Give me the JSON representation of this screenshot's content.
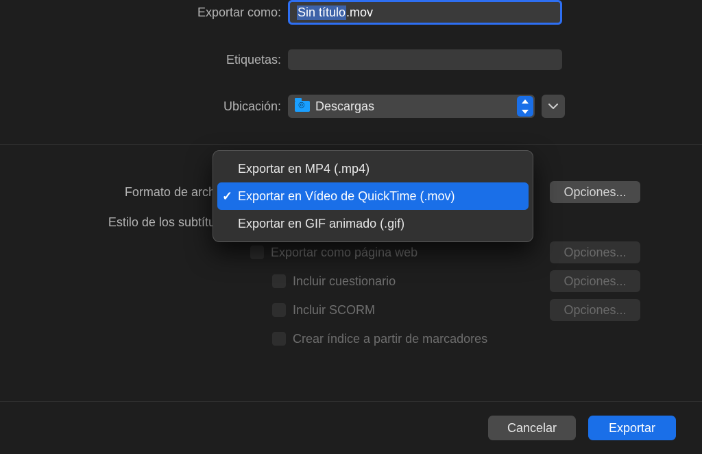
{
  "labels": {
    "export_as": "Exportar como:",
    "tags": "Etiquetas:",
    "location": "Ubicación:",
    "file_format": "Formato de archivo:",
    "subtitle_style": "Estilo de los subtítulos:"
  },
  "filename": {
    "selected_part": "Sin título",
    "rest_part": ".mov"
  },
  "location": {
    "name": "Descargas"
  },
  "format_menu": {
    "items": [
      "Exportar en MP4 (.mp4)",
      "Exportar en Vídeo de QuickTime (.mov)",
      "Exportar en GIF animado (.gif)"
    ],
    "selected_index": 1
  },
  "checkboxes": {
    "export_web": "Exportar como página web",
    "include_quiz": "Incluir cuestionario",
    "include_scorm": "Incluir SCORM",
    "create_index": "Crear índice a partir de marcadores"
  },
  "buttons": {
    "options": "Opciones...",
    "cancel": "Cancelar",
    "export": "Exportar"
  }
}
